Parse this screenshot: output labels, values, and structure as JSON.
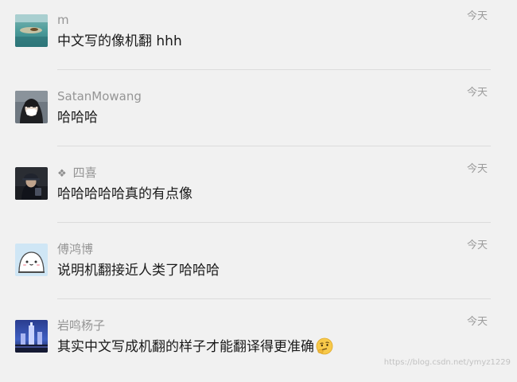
{
  "comments": [
    {
      "name": "m",
      "name_prefix": "",
      "time": "今天",
      "text": "中文写的像机翻 hhh",
      "avatar": "seascape-photo"
    },
    {
      "name": "SatanMowang",
      "name_prefix": "",
      "time": "今天",
      "text": "哈哈哈",
      "avatar": "masked-person-photo"
    },
    {
      "name": "四喜",
      "name_prefix": "❖",
      "time": "今天",
      "text": "哈哈哈哈哈真的有点像",
      "avatar": "person-in-cap-photo"
    },
    {
      "name": "傅鸿博",
      "name_prefix": "",
      "time": "今天",
      "text": "说明机翻接近人类了哈哈哈",
      "avatar": "cartoon-rice-ball"
    },
    {
      "name": "岩鸣杨子",
      "name_prefix": "",
      "time": "今天",
      "text": "其实中文写成机翻的样子才能翻译得更准确",
      "avatar": "night-building-photo",
      "trailing_emoji": "thinking-face-emoji"
    }
  ],
  "watermark": "https://blog.csdn.net/ymyz1229"
}
